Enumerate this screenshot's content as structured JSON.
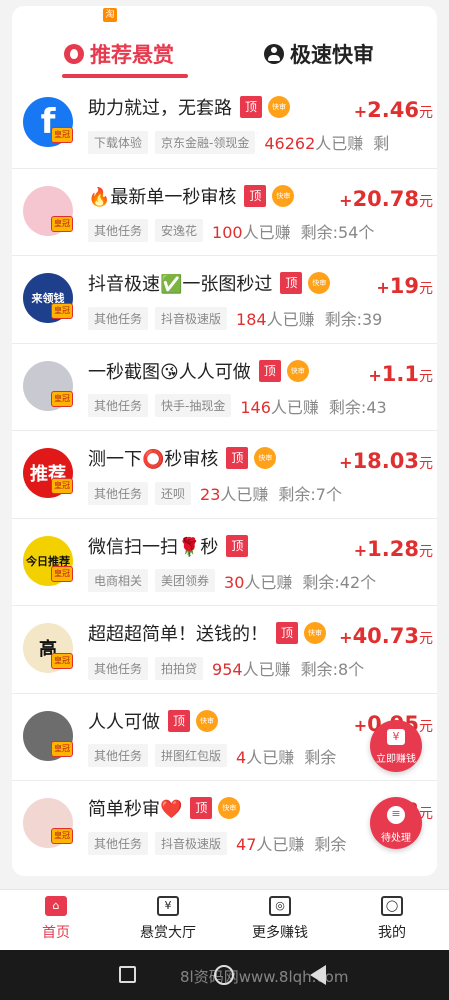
{
  "top_badge": "淘",
  "tabs": [
    {
      "label": "推荐悬赏"
    },
    {
      "label": "极速快审"
    }
  ],
  "tag_top": "顶",
  "tag_fast": "快审",
  "crown_label": "皇冠",
  "tasks": [
    {
      "title": "助力就过，无套路",
      "top": true,
      "fast": true,
      "reward": "2.46",
      "category": "下载体验",
      "app": "京东金融-领现金",
      "earned_count": "46262",
      "remaining": "剩",
      "avatar_text": "f",
      "avatar_bg": "#1877f2"
    },
    {
      "title": "🔥最新单一秒审核",
      "top": true,
      "fast": true,
      "reward": "20.78",
      "category": "其他任务",
      "app": "安逸花",
      "earned_count": "100",
      "remaining": "剩余:54个",
      "avatar_text": "",
      "avatar_bg": "#f6c6d0"
    },
    {
      "title": "抖音极速✅一张图秒过",
      "top": true,
      "fast": true,
      "reward": "19",
      "category": "其他任务",
      "app": "抖音极速版",
      "earned_count": "184",
      "remaining": "剩余:39",
      "avatar_text": "来领钱",
      "avatar_bg": "#1d3f8c"
    },
    {
      "title": "一秒截图😘人人可做",
      "top": true,
      "fast": true,
      "reward": "1.1",
      "category": "其他任务",
      "app": "快手-抽现金",
      "earned_count": "146",
      "remaining": "剩余:43",
      "avatar_text": "",
      "avatar_bg": "#c9c9d1"
    },
    {
      "title": "测一下⭕秒审核",
      "top": true,
      "fast": true,
      "reward": "18.03",
      "category": "其他任务",
      "app": "还呗",
      "earned_count": "23",
      "remaining": "剩余:7个",
      "avatar_text": "推荐",
      "avatar_bg": "#e01818"
    },
    {
      "title": "微信扫一扫🌹秒",
      "top": true,
      "fast": false,
      "reward": "1.28",
      "category": "电商相关",
      "app": "美团领券",
      "earned_count": "30",
      "remaining": "剩余:42个",
      "avatar_text": "今日推荐",
      "avatar_bg": "#f3d000"
    },
    {
      "title": "超超超简单！送钱的！",
      "top": true,
      "fast": true,
      "reward": "40.73",
      "category": "其他任务",
      "app": "拍拍贷",
      "earned_count": "954",
      "remaining": "剩余:8个",
      "avatar_text": "高",
      "avatar_bg": "#f4e7c8"
    },
    {
      "title": "人人可做",
      "top": true,
      "fast": true,
      "reward": "0.95",
      "category": "其他任务",
      "app": "拼图红包版",
      "earned_count": "4",
      "remaining": "剩余",
      "avatar_text": "",
      "avatar_bg": "#6d6d6d"
    },
    {
      "title": "简单秒审❤️",
      "top": true,
      "fast": true,
      "reward": "3",
      "category": "其他任务",
      "app": "抖音极速版",
      "earned_count": "47",
      "remaining": "剩余",
      "avatar_text": "",
      "avatar_bg": "#f1d6d2"
    }
  ],
  "earned_suffix": "人已赚",
  "currency_unit": "元",
  "plus": "+",
  "float_buttons": {
    "earn": {
      "icon": "¥",
      "label": "立即赚钱"
    },
    "pending": {
      "icon": "≡",
      "label": "待处理"
    }
  },
  "tabbar": [
    {
      "label": "首页",
      "icon": "home-icon",
      "active": true
    },
    {
      "label": "悬赏大厅",
      "icon": "yen-icon",
      "active": false
    },
    {
      "label": "更多赚钱",
      "icon": "gamepad-icon",
      "active": false
    },
    {
      "label": "我的",
      "icon": "user-icon",
      "active": false
    }
  ],
  "tabbar_glyphs": [
    "⌂",
    "¥",
    "◎",
    "◯"
  ],
  "watermark": "8l资码网www.8lqh.com"
}
